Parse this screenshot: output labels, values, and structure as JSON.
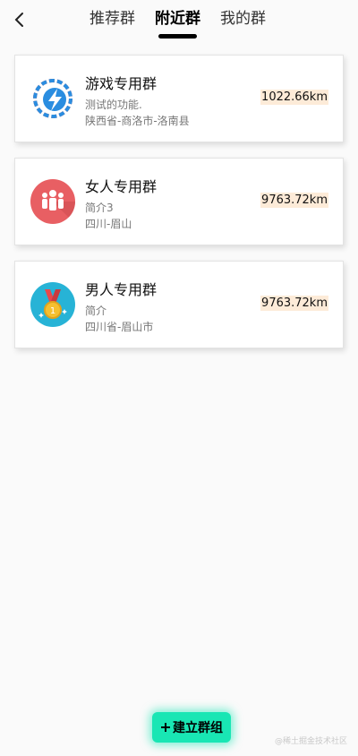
{
  "header": {
    "back_icon": "chevron-left-icon",
    "tabs": [
      {
        "label": "推荐群",
        "active": false
      },
      {
        "label": "附近群",
        "active": true
      },
      {
        "label": "我的群",
        "active": false
      }
    ]
  },
  "groups": [
    {
      "name": "游戏专用群",
      "description": "测试的功能.",
      "location": "陕西省-商洛市-洛南县",
      "distance": "1022.66km",
      "icon": "lightning-logo-icon"
    },
    {
      "name": "女人专用群",
      "description": "简介3",
      "location": "四川-眉山",
      "distance": "9763.72km",
      "icon": "people-icon"
    },
    {
      "name": "男人专用群",
      "description": "简介",
      "location": "四川省-眉山市",
      "distance": "9763.72km",
      "icon": "medal-icon"
    }
  ],
  "create_button": {
    "label": "建立群组",
    "icon": "plus-icon"
  },
  "watermark": "@稀土掘金技术社区",
  "colors": {
    "accent": "#19e6b4",
    "distance_bg": "#fdebd8",
    "avatar2_bg": "#e85f63",
    "avatar3_bg": "#27b3d6"
  }
}
